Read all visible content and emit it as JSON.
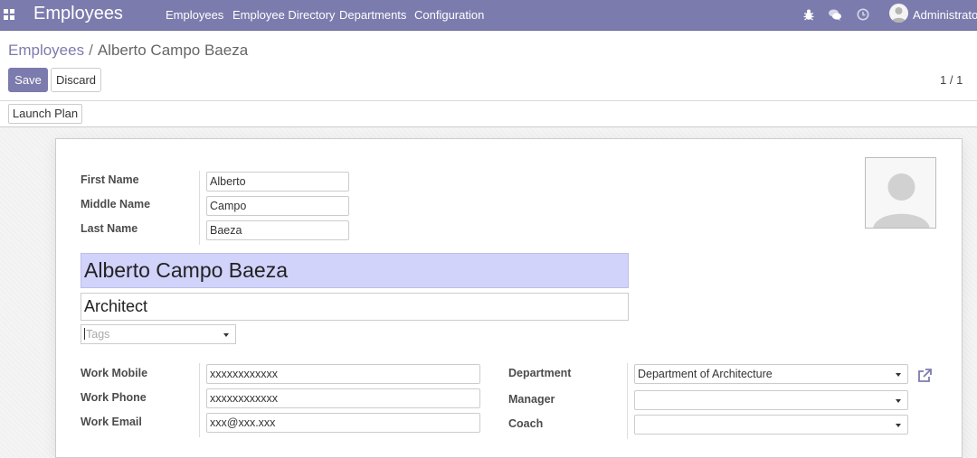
{
  "navbar": {
    "app_name": "Employees",
    "menu": [
      "Employees",
      "Employee Directory",
      "Departments",
      "Configuration"
    ],
    "user_name": "Administrator",
    "icons": [
      "apps-grid-icon",
      "bug-icon",
      "chat-icon",
      "clock-icon"
    ],
    "color": "#7c7bad"
  },
  "breadcrumb": {
    "parent": "Employees",
    "separator": "/",
    "current": "Alberto Campo Baeza"
  },
  "buttons": {
    "save": "Save",
    "discard": "Discard",
    "launch_plan": "Launch Plan"
  },
  "pager": "1 / 1",
  "form": {
    "labels": {
      "first_name": "First Name",
      "middle_name": "Middle Name",
      "last_name": "Last Name",
      "work_mobile": "Work Mobile",
      "work_phone": "Work Phone",
      "work_email": "Work Email",
      "department": "Department",
      "manager": "Manager",
      "coach": "Coach"
    },
    "values": {
      "first_name": "Alberto",
      "middle_name": "Campo",
      "last_name": "Baeza",
      "full_name": "Alberto Campo Baeza",
      "job_title": "Architect",
      "tags_placeholder": "Tags",
      "work_mobile": "xxxxxxxxxxxx",
      "work_phone": "xxxxxxxxxxxx",
      "work_email": "xxx@xxx.xxx",
      "department": "Department of Architecture",
      "manager": "",
      "coach": ""
    },
    "highlight_color": "#d1d3fb"
  }
}
